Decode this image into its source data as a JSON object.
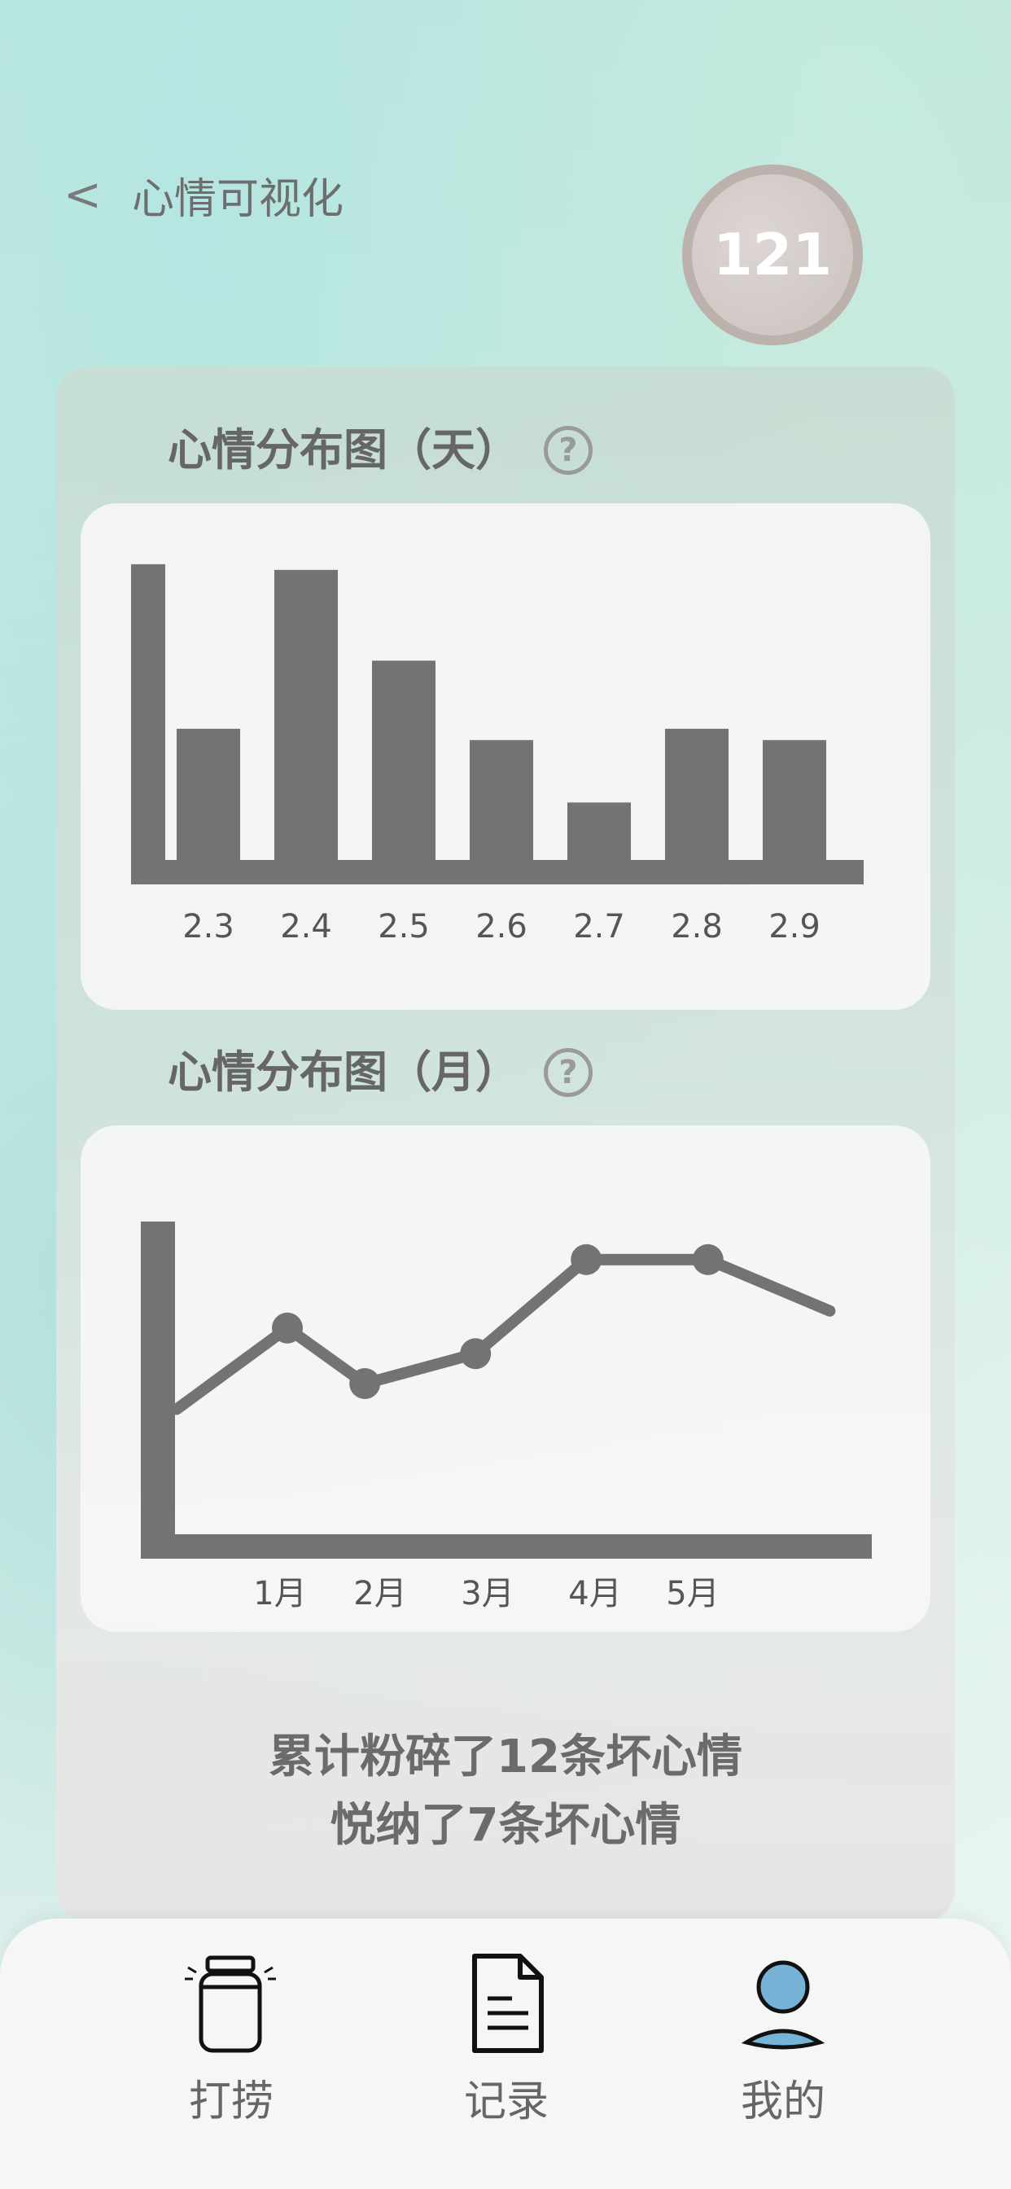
{
  "header": {
    "back_label": "<",
    "title": "心情可视化",
    "avatar_value": "121"
  },
  "daily_section": {
    "title": "心情分布图（天）",
    "help": "?"
  },
  "monthly_section": {
    "title": "心情分布图（月）",
    "help": "?"
  },
  "chart_data": [
    {
      "type": "bar",
      "title": "心情分布图（天）",
      "categories": [
        "2.3",
        "2.4",
        "2.5",
        "2.6",
        "2.7",
        "2.8",
        "2.9"
      ],
      "values": [
        2.6,
        5.4,
        3.8,
        2.4,
        1.3,
        2.6,
        2.4
      ],
      "extra_left_bar_value": 5.5,
      "ylim": [
        0,
        6
      ],
      "grid": false,
      "color": "#737373"
    },
    {
      "type": "line",
      "title": "心情分布图（月）",
      "categories": [
        "1月",
        "2月",
        "3月",
        "4月",
        "5月"
      ],
      "points": [
        {
          "x": 0.0,
          "y": 3.0
        },
        {
          "x": 1.0,
          "y": 4.9
        },
        {
          "x": 1.7,
          "y": 3.6
        },
        {
          "x": 2.7,
          "y": 4.3
        },
        {
          "x": 3.7,
          "y": 6.5
        },
        {
          "x": 4.8,
          "y": 6.5
        },
        {
          "x": 5.9,
          "y": 5.3
        }
      ],
      "marked_points": [
        1,
        2,
        3,
        4,
        5
      ],
      "ylim": [
        0,
        8
      ],
      "grid": false,
      "color": "#737373"
    }
  ],
  "summary": {
    "line1": "累计粉碎了12条坏心情",
    "line2": "悦纳了7条坏心情"
  },
  "nav": {
    "items": [
      {
        "label": "打捞",
        "icon": "jar-icon"
      },
      {
        "label": "记录",
        "icon": "document-icon"
      },
      {
        "label": "我的",
        "icon": "user-icon"
      }
    ]
  },
  "colors": {
    "chart_gray": "#737373",
    "avatar_border": "#bdb1ad",
    "user_icon_blue": "#76b3d6"
  }
}
